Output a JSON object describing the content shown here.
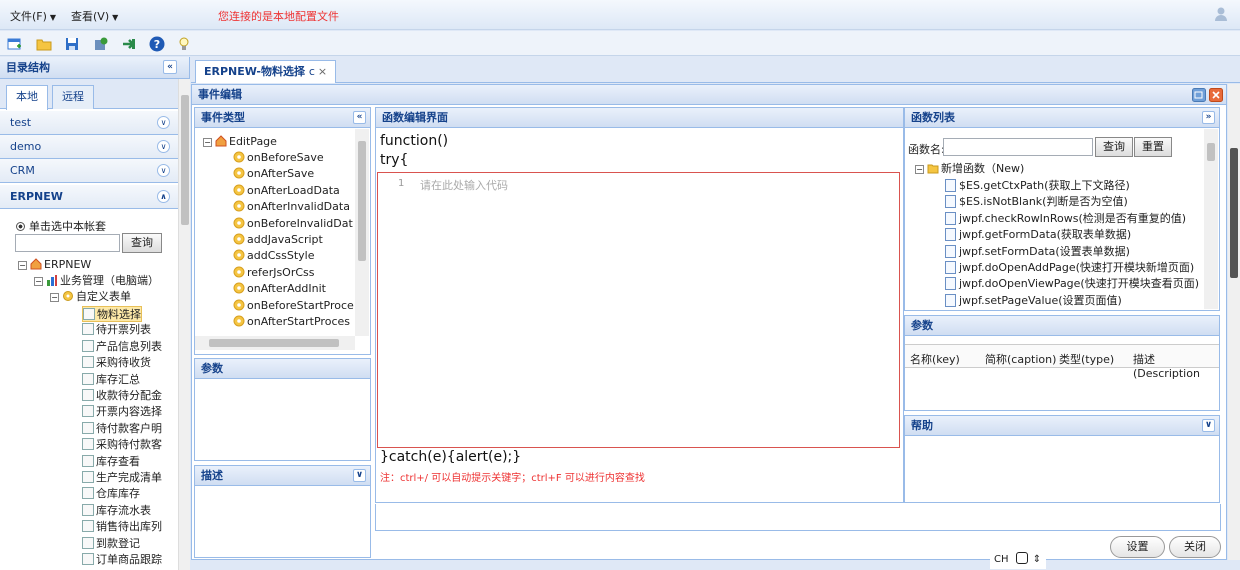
{
  "menu": {
    "file": "文件(F)",
    "view": "查看(V)",
    "notice": "您连接的是本地配置文件"
  },
  "colors": {
    "accent": "#15428b",
    "border": "#99bbe8",
    "notice": "#e33333",
    "editor_border": "#d9534f"
  },
  "toolbar": {
    "icons": [
      "new-icon",
      "open-folder-icon",
      "save-icon",
      "settings-icon",
      "refresh-icon",
      "help-icon",
      "bulb-icon"
    ]
  },
  "left": {
    "title": "目录结构",
    "collapse": "«",
    "tabs": [
      "本地",
      "远程"
    ],
    "accordion": [
      "test",
      "demo",
      "CRM",
      "ERPNEW"
    ],
    "radio_label": "单击选中本帐套",
    "search_button": "查询",
    "tree": {
      "root": "ERPNEW",
      "level1": "业务管理（电脑端）",
      "level2": "自定义表单",
      "items": [
        "物料选择",
        "待开票列表",
        "产品信息列表",
        "采购待收货",
        "库存汇总",
        "收款待分配金",
        "开票内容选择",
        "待付款客户明",
        "采购待付款客",
        "库存查看",
        "生产完成清单",
        "仓库库存",
        "库存流水表",
        "销售待出库列",
        "到款登记",
        "订单商品跟踪"
      ]
    }
  },
  "main_tab": {
    "label": "ERPNEW-物料选择",
    "suffix": "c",
    "close": "×"
  },
  "edit_panel": {
    "title": "事件编辑"
  },
  "event_types": {
    "title": "事件类型",
    "root": "EditPage",
    "items": [
      "onBeforeSave",
      "onAfterSave",
      "onAfterLoadData",
      "onAfterInvalidData",
      "onBeforeInvalidDat",
      "addJavaScript",
      "addCssStyle",
      "referJsOrCss",
      "onAfterAddInit",
      "onBeforeStartProce",
      "onAfterStartProces"
    ]
  },
  "params_left": {
    "title": "参数"
  },
  "desc": {
    "title": "描述"
  },
  "func_editor": {
    "title": "函数编辑界面",
    "line1": "function()",
    "line2": "try{",
    "line_number": "1",
    "placeholder": "请在此处输入代码",
    "line_end": "}catch(e){alert(e);}",
    "note": "注：ctrl+/ 可以自动提示关键字；ctrl+F 可以进行内容查找"
  },
  "func_list": {
    "title": "函数列表",
    "search_label": "函数名:",
    "query": "查询",
    "reset": "重置",
    "group": "新增函数（New)",
    "items": [
      "$ES.getCtxPath(获取上下文路径)",
      "$ES.isNotBlank(判断是否为空值)",
      "jwpf.checkRowInRows(检测是否有重复的值)",
      "jwpf.getFormData(获取表单数据)",
      "jwpf.setFormData(设置表单数据)",
      "jwpf.doOpenAddPage(快速打开模块新增页面)",
      "jwpf.doOpenViewPage(快速打开模块查看页面)",
      "jwpf.setPageValue(设置页面值)"
    ]
  },
  "params_right": {
    "title": "参数",
    "columns": [
      "名称(key)",
      "简称(caption)",
      "类型(type)",
      "描述(Description"
    ]
  },
  "help": {
    "title": "帮助"
  },
  "footer": {
    "settings": "设置",
    "close": "关闭"
  },
  "ime": {
    "label": "CH"
  }
}
